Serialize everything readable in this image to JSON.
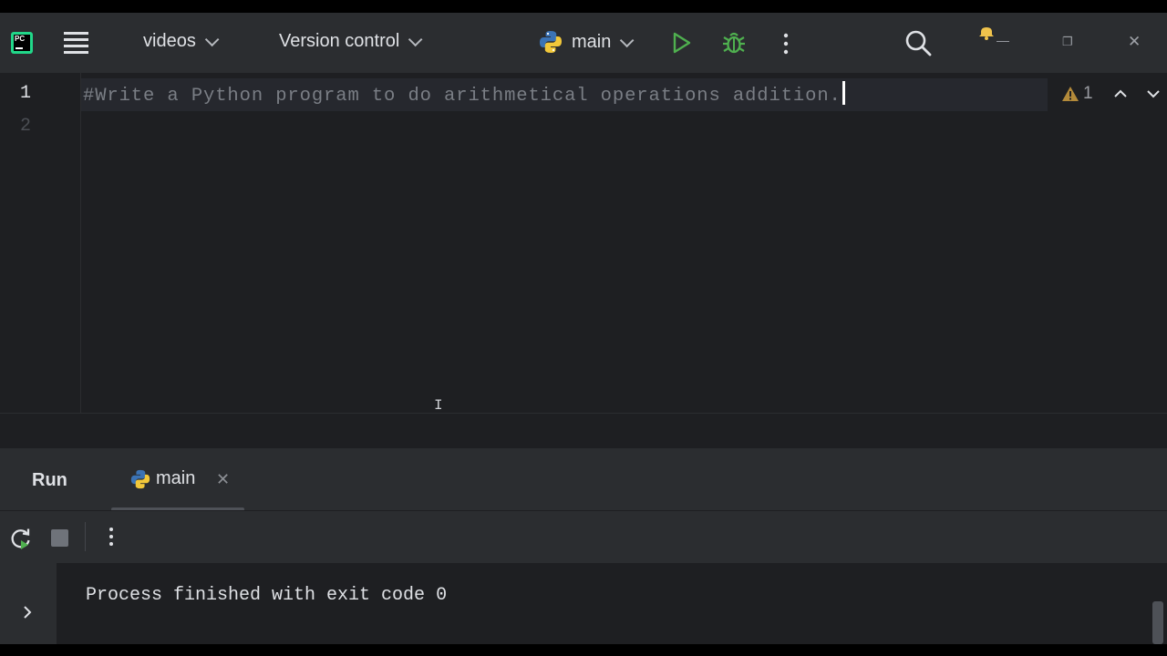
{
  "toolbar": {
    "project": "videos",
    "vcs": "Version control",
    "run_config": "main",
    "colors": {
      "run": "#4fb04f",
      "debug": "#4fb04f"
    }
  },
  "editor": {
    "line_numbers": [
      "1",
      "2"
    ],
    "code_line_1": "#Write a Python program to do arithmetical operations addition.",
    "warning_count": "1"
  },
  "run_panel": {
    "title": "Run",
    "tab_label": "main",
    "console_output": "Process finished with exit code 0"
  }
}
